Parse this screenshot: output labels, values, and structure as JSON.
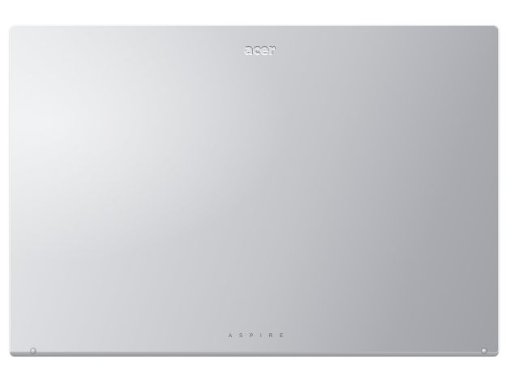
{
  "product": {
    "brand_logo_text": "acer",
    "series_label": "ASPIRE"
  },
  "colors": {
    "lid_light": "#e9eaec",
    "lid_dark": "#a0a1a6",
    "logo": "#d9dadd",
    "series_text": "#56575c"
  },
  "icons": [
    "acer-logo-icon",
    "screw-icon"
  ]
}
